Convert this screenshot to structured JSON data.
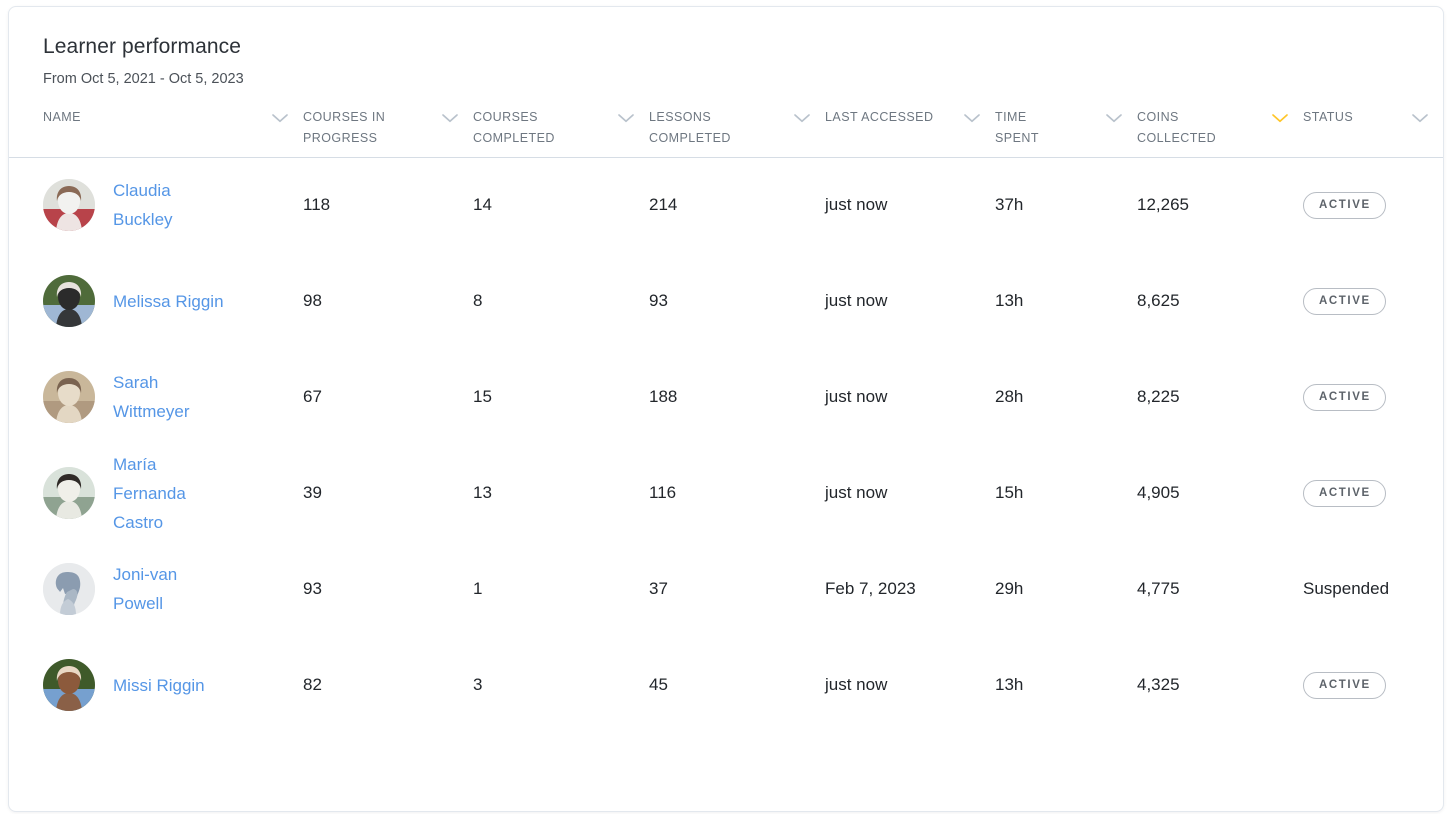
{
  "card": {
    "title": "Learner performance",
    "subtitle": "From Oct 5, 2021 - Oct 5, 2023"
  },
  "colors": {
    "link": "#5596e6",
    "active_sort_chevron": "#ffc629",
    "idle_chevron": "#b9c2cc",
    "header_text": "#6e7781",
    "divider": "#d6dde5"
  },
  "table": {
    "columns": [
      {
        "key": "name",
        "label": "NAME",
        "sort_icon": "chevron-down-icon",
        "sort_active": false
      },
      {
        "key": "courses_progress",
        "label": "COURSES IN\nPROGRESS",
        "sort_icon": "chevron-down-icon",
        "sort_active": false
      },
      {
        "key": "courses_completed",
        "label": "COURSES\nCOMPLETED",
        "sort_icon": "chevron-down-icon",
        "sort_active": false
      },
      {
        "key": "lessons_completed",
        "label": "LESSONS\nCOMPLETED",
        "sort_icon": "chevron-down-icon",
        "sort_active": false
      },
      {
        "key": "last_accessed",
        "label": "LAST ACCESSED",
        "sort_icon": "chevron-down-icon",
        "sort_active": false
      },
      {
        "key": "time_spent",
        "label": "TIME\nSPENT",
        "sort_icon": "chevron-down-icon",
        "sort_active": false
      },
      {
        "key": "coins_collected",
        "label": "COINS\nCOLLECTED",
        "sort_icon": "chevron-down-icon",
        "sort_active": true
      },
      {
        "key": "status",
        "label": "STATUS",
        "sort_icon": "chevron-down-icon",
        "sort_active": false
      }
    ],
    "rows": [
      {
        "name": "Claudia Buckley",
        "avatar": "photo",
        "courses_progress": "118",
        "courses_completed": "14",
        "lessons_completed": "214",
        "last_accessed": "just now",
        "time_spent": "37h",
        "coins_collected": "12,265",
        "status": "ACTIVE",
        "status_style": "badge"
      },
      {
        "name": "Melissa Riggin",
        "avatar": "photo",
        "courses_progress": "98",
        "courses_completed": "8",
        "lessons_completed": "93",
        "last_accessed": "just now",
        "time_spent": "13h",
        "coins_collected": "8,625",
        "status": "ACTIVE",
        "status_style": "badge"
      },
      {
        "name": "Sarah Wittmeyer",
        "avatar": "photo",
        "courses_progress": "67",
        "courses_completed": "15",
        "lessons_completed": "188",
        "last_accessed": "just now",
        "time_spent": "28h",
        "coins_collected": "8,225",
        "status": "ACTIVE",
        "status_style": "badge"
      },
      {
        "name": "María Fernanda Castro",
        "avatar": "photo",
        "courses_progress": "39",
        "courses_completed": "13",
        "lessons_completed": "116",
        "last_accessed": "just now",
        "time_spent": "15h",
        "coins_collected": "4,905",
        "status": "ACTIVE",
        "status_style": "badge"
      },
      {
        "name": "Joni-van Powell",
        "avatar": "placeholder",
        "courses_progress": "93",
        "courses_completed": "1",
        "lessons_completed": "37",
        "last_accessed": "Feb 7, 2023",
        "time_spent": "29h",
        "coins_collected": "4,775",
        "status": "Suspended",
        "status_style": "plain"
      },
      {
        "name": "Missi Riggin",
        "avatar": "photo",
        "courses_progress": "82",
        "courses_completed": "3",
        "lessons_completed": "45",
        "last_accessed": "just now",
        "time_spent": "13h",
        "coins_collected": "4,325",
        "status": "ACTIVE",
        "status_style": "badge"
      }
    ]
  }
}
